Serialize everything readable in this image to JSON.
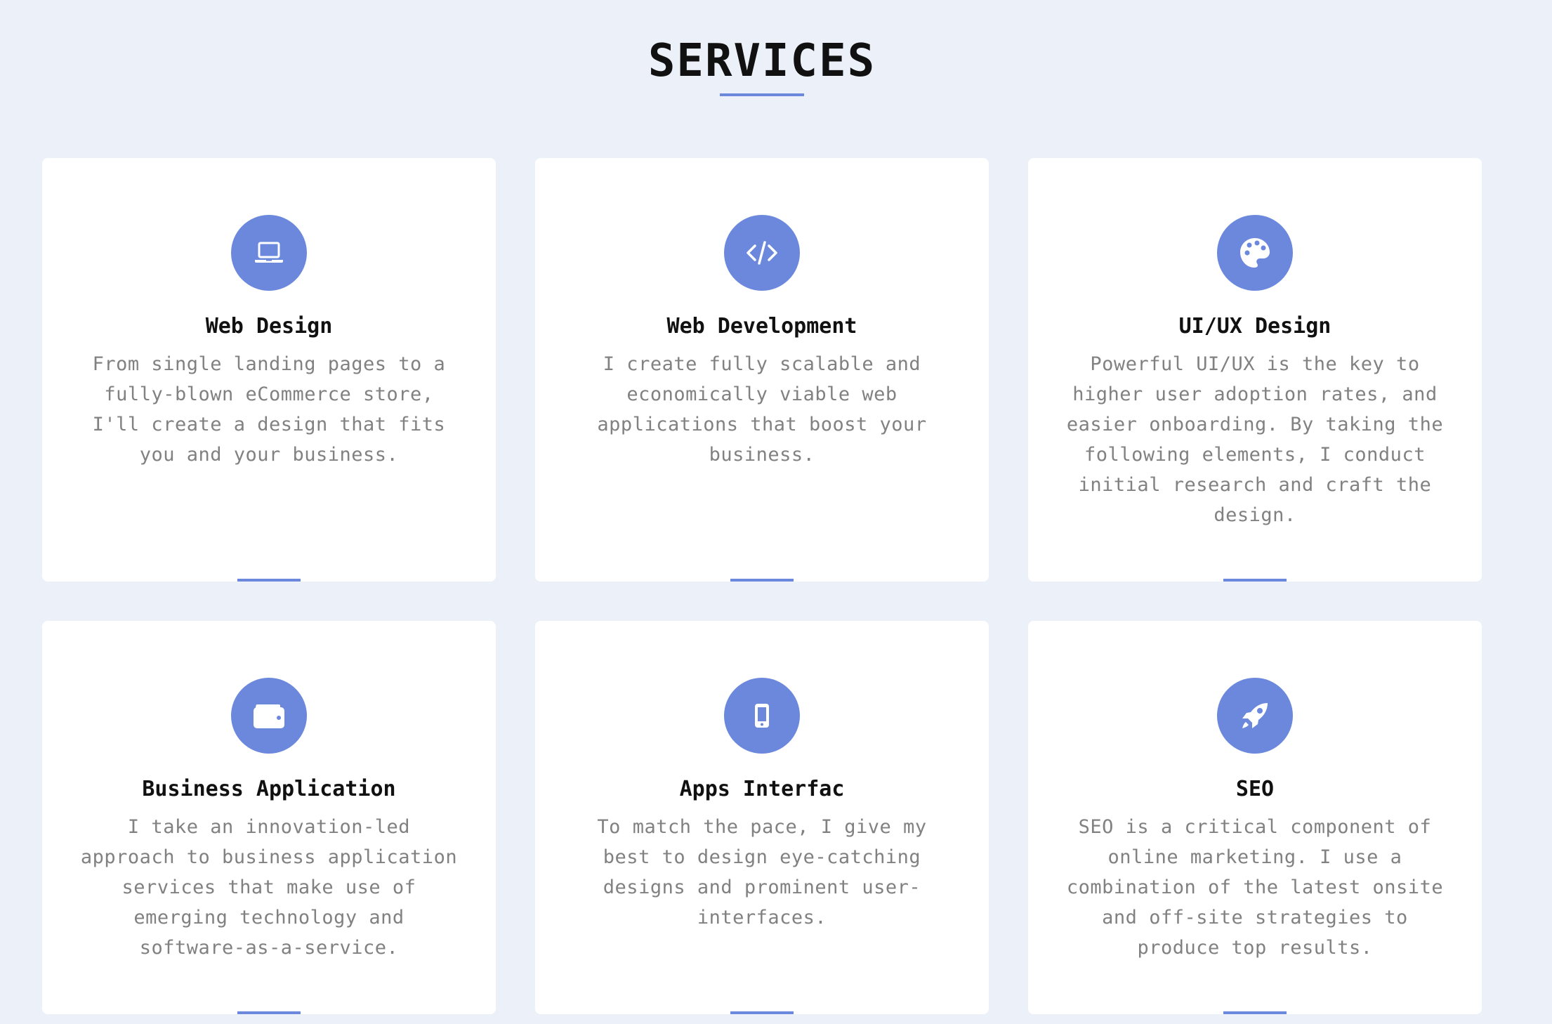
{
  "section": {
    "title": "SERVICES"
  },
  "colors": {
    "accent": "#6b88dd",
    "background": "#ecf1f9",
    "card": "#ffffff",
    "heading": "#111111",
    "body_text": "#818181"
  },
  "services": [
    {
      "icon": "laptop-icon",
      "title": "Web Design",
      "description": "From single landing pages to a fully-blown eCommerce store, I'll create a design that fits you and your business."
    },
    {
      "icon": "code-icon",
      "title": "Web Development",
      "description": "I create fully scalable and economically viable web applications that boost your business."
    },
    {
      "icon": "palette-icon",
      "title": "UI/UX Design",
      "description": "Powerful UI/UX is the key to higher user adoption rates, and easier onboarding. By taking the following elements, I conduct initial research and craft the design."
    },
    {
      "icon": "wallet-icon",
      "title": "Business Application",
      "description": "I take an innovation-led approach to business application services that make use of emerging technology and software-as-a-service."
    },
    {
      "icon": "mobile-icon",
      "title": "Apps Interfac",
      "description": "To match the pace, I give my best to design eye-catching designs and prominent user-interfaces."
    },
    {
      "icon": "rocket-icon",
      "title": "SEO",
      "description": "SEO is a critical component of online marketing. I use a combination of the latest onsite and off-site strategies to produce top results."
    }
  ]
}
